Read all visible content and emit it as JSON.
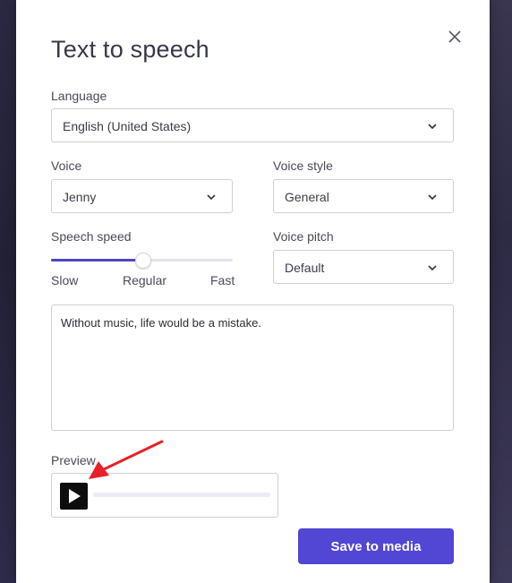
{
  "dialog": {
    "title": "Text to speech"
  },
  "language": {
    "label": "Language",
    "value": "English (United States)"
  },
  "voice": {
    "label": "Voice",
    "value": "Jenny"
  },
  "voice_style": {
    "label": "Voice style",
    "value": "General"
  },
  "speech_speed": {
    "label": "Speech speed",
    "slow": "Slow",
    "regular": "Regular",
    "fast": "Fast",
    "level": 0.5
  },
  "voice_pitch": {
    "label": "Voice pitch",
    "value": "Default"
  },
  "script_text": "Without music, life would be a mistake.",
  "preview": {
    "label": "Preview",
    "progress": 0
  },
  "save_button": "Save to media",
  "colors": {
    "accent": "#5147d4",
    "slider_fill": "#4d46c4",
    "annotation_arrow": "#e8202a"
  },
  "icons": {
    "close": "close-icon",
    "chevron": "chevron-down-icon",
    "play": "play-icon"
  }
}
